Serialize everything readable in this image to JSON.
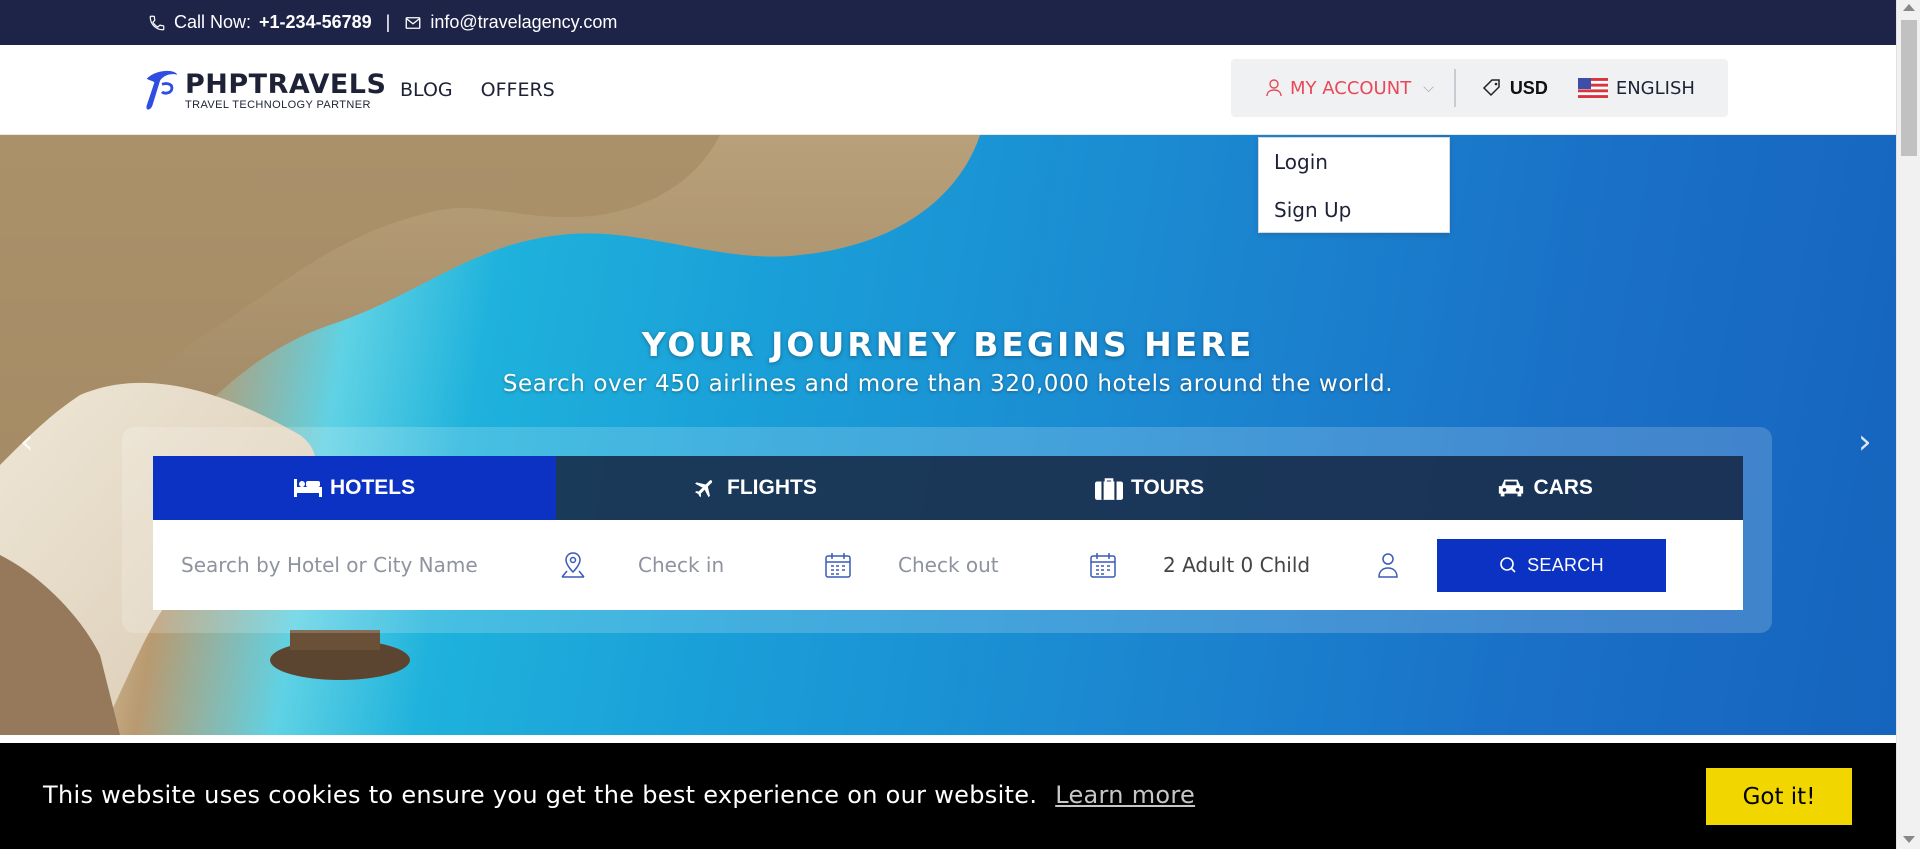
{
  "topbar": {
    "call_label": "Call Now:",
    "phone": "+1-234-56789",
    "separator": "|",
    "email": "info@travelagency.com"
  },
  "brand": {
    "name": "PHPTRAVELS",
    "tagline": "TRAVEL TECHNOLOGY PARTNER"
  },
  "nav": {
    "items": [
      "BLOG",
      "OFFERS"
    ]
  },
  "account": {
    "label": "MY ACCOUNT",
    "currency": "USD",
    "language": "ENGLISH",
    "dropdown": [
      "Login",
      "Sign Up"
    ]
  },
  "hero": {
    "title": "YOUR JOURNEY BEGINS HERE",
    "subtitle": "Search over 450 airlines and more than 320,000 hotels around the world."
  },
  "tabs": [
    {
      "label": "HOTELS",
      "icon": "bed-icon",
      "active": true
    },
    {
      "label": "FLIGHTS",
      "icon": "plane-icon",
      "active": false
    },
    {
      "label": "TOURS",
      "icon": "suitcase-icon",
      "active": false
    },
    {
      "label": "CARS",
      "icon": "car-icon",
      "active": false
    }
  ],
  "search": {
    "hotel_placeholder": "Search by Hotel or City Name",
    "checkin": "Check in",
    "checkout": "Check out",
    "guests": "2 Adult 0 Child",
    "button": "SEARCH"
  },
  "cookie": {
    "message": "This website uses cookies to ensure you get the best experience on our website.",
    "learn_more": "Learn more",
    "accept": "Got it!"
  },
  "colors": {
    "topbar_bg": "#1d2448",
    "primary_blue": "#0b32c2",
    "account_red": "#e8495a",
    "cookie_bg": "#000000",
    "cookie_button": "#f1d600"
  }
}
